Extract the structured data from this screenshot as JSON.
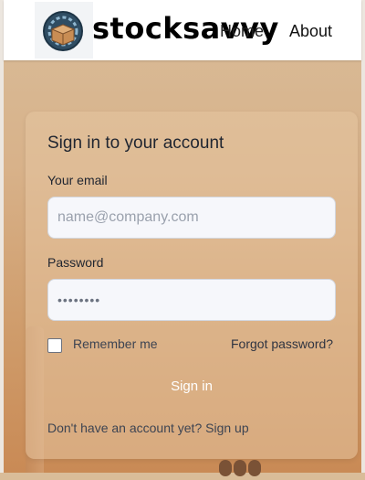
{
  "brand": {
    "name": "stocksavvy",
    "logo": "box-on-gear-icon"
  },
  "nav": {
    "items": [
      {
        "label": "Home"
      },
      {
        "label": "About"
      }
    ]
  },
  "login": {
    "title": "Sign in to your account",
    "email_label": "Your email",
    "email_placeholder": "name@company.com",
    "password_label": "Password",
    "password_value": "••••••••",
    "remember_label": "Remember me",
    "remember_checked": false,
    "forgot_label": "Forgot password?",
    "submit_label": "Sign in",
    "signup_prompt": "Don't have an account yet?",
    "signup_link": "Sign up"
  },
  "colors": {
    "page_background": "#d8b28a",
    "card_background": "#e6c4a0",
    "input_background": "#f6f7fb",
    "text_primary": "#1f2530"
  }
}
